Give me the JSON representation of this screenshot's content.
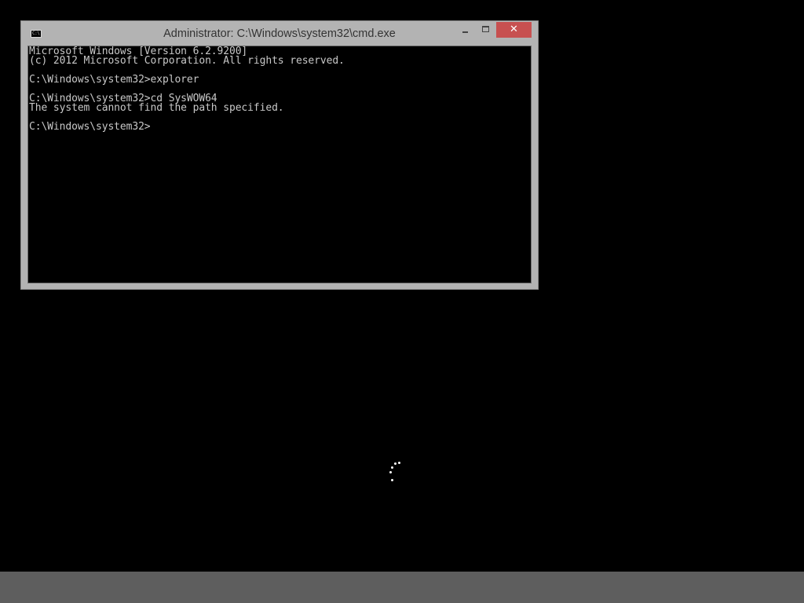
{
  "window": {
    "title": "Administrator: C:\\Windows\\system32\\cmd.exe",
    "icon": "cmd-icon",
    "icon_glyph": "C:\\",
    "buttons": {
      "minimize_icon": "minimize-icon",
      "maximize_icon": "maximize-icon",
      "close_icon": "close-icon",
      "close_glyph": "✕"
    },
    "colors": {
      "frame": "#b3b3b3",
      "close_button": "#c75050",
      "console_background": "#000000",
      "console_text": "#c8c8c8"
    }
  },
  "console": {
    "lines": [
      "Microsoft Windows [Version 6.2.9200]",
      "(c) 2012 Microsoft Corporation. All rights reserved.",
      "",
      "C:\\Windows\\system32>explorer",
      "",
      "C:\\Windows\\system32>cd SysWOW64",
      "The system cannot find the path specified.",
      "",
      "C:\\Windows\\system32>"
    ]
  },
  "desktop": {
    "background": "#000000",
    "spinner_icon": "loading-spinner-icon"
  },
  "taskbar": {
    "color": "#5e5e5e"
  }
}
